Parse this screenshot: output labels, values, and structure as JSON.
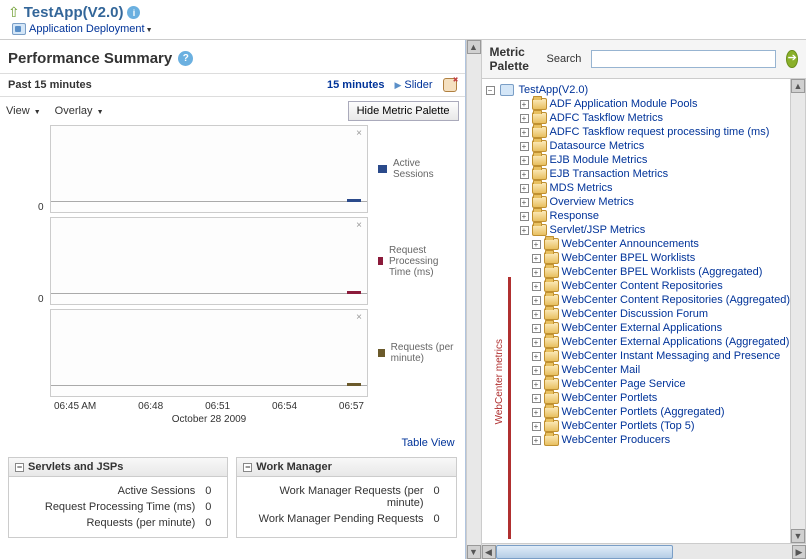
{
  "header": {
    "app_title": "TestApp(V2.0)",
    "deployment_menu": "Application Deployment"
  },
  "perf": {
    "title": "Performance Summary",
    "past_label": "Past 15 minutes",
    "minutes_link": "15 minutes",
    "slider": "Slider",
    "view_menu": "View",
    "overlay_menu": "Overlay",
    "hide_palette_btn": "Hide Metric Palette",
    "table_view": "Table View",
    "xaxis_date": "October 28 2009"
  },
  "chart_data": [
    {
      "type": "line",
      "legend": "Active Sessions",
      "color": "#2b4a8b",
      "x": [
        "06:45 AM",
        "06:48",
        "06:51",
        "06:54",
        "06:57"
      ],
      "values": [
        0,
        0,
        0,
        0,
        0
      ],
      "ylim": [
        0,
        null
      ],
      "y_tick": "0"
    },
    {
      "type": "line",
      "legend": "Request Processing Time (ms)",
      "color": "#8b1a3a",
      "x": [
        "06:45 AM",
        "06:48",
        "06:51",
        "06:54",
        "06:57"
      ],
      "values": [
        0,
        0,
        0,
        0,
        0
      ],
      "ylim": [
        0,
        null
      ],
      "y_tick": "0"
    },
    {
      "type": "line",
      "legend": "Requests (per minute)",
      "color": "#6b5a2b",
      "x": [
        "06:45 AM",
        "06:48",
        "06:51",
        "06:54",
        "06:57"
      ],
      "values": [
        0,
        0,
        0,
        0,
        0
      ],
      "ylim": [
        0,
        null
      ],
      "y_tick": ""
    }
  ],
  "xaxis_ticks": [
    "06:45 AM",
    "06:48",
    "06:51",
    "06:54",
    "06:57"
  ],
  "panels": {
    "servlets": {
      "title": "Servlets and JSPs",
      "rows": [
        {
          "k": "Active Sessions",
          "v": "0"
        },
        {
          "k": "Request Processing Time (ms)",
          "v": "0"
        },
        {
          "k": "Requests (per minute)",
          "v": "0"
        }
      ]
    },
    "workmgr": {
      "title": "Work Manager",
      "rows": [
        {
          "k": "Work Manager Requests (per minute)",
          "v": "0"
        },
        {
          "k": "Work Manager Pending Requests",
          "v": "0"
        }
      ]
    }
  },
  "palette": {
    "title": "Metric Palette",
    "search_label": "Search",
    "search_value": "",
    "root": "TestApp(V2.0)",
    "wc_label": "WebCenter metrics",
    "nodes": [
      {
        "label": "ADF Application Module Pools",
        "sub": false
      },
      {
        "label": "ADFC Taskflow Metrics",
        "sub": false
      },
      {
        "label": "ADFC Taskflow request processing time (ms)",
        "sub": false
      },
      {
        "label": "Datasource Metrics",
        "sub": false
      },
      {
        "label": "EJB Module Metrics",
        "sub": false
      },
      {
        "label": "EJB Transaction Metrics",
        "sub": false
      },
      {
        "label": "MDS Metrics",
        "sub": false
      },
      {
        "label": "Overview Metrics",
        "sub": false
      },
      {
        "label": "Response",
        "sub": false
      },
      {
        "label": "Servlet/JSP Metrics",
        "sub": false
      },
      {
        "label": "WebCenter Announcements",
        "sub": true
      },
      {
        "label": "WebCenter BPEL Worklists",
        "sub": true
      },
      {
        "label": "WebCenter BPEL Worklists (Aggregated)",
        "sub": true
      },
      {
        "label": "WebCenter Content Repositories",
        "sub": true
      },
      {
        "label": "WebCenter Content Repositories (Aggregated)",
        "sub": true
      },
      {
        "label": "WebCenter Discussion Forum",
        "sub": true
      },
      {
        "label": "WebCenter External Applications",
        "sub": true
      },
      {
        "label": "WebCenter External Applications (Aggregated)",
        "sub": true
      },
      {
        "label": "WebCenter Instant Messaging and Presence",
        "sub": true
      },
      {
        "label": "WebCenter Mail",
        "sub": true
      },
      {
        "label": "WebCenter Page Service",
        "sub": true
      },
      {
        "label": "WebCenter Portlets",
        "sub": true
      },
      {
        "label": "WebCenter Portlets (Aggregated)",
        "sub": true
      },
      {
        "label": "WebCenter Portlets (Top 5)",
        "sub": true
      },
      {
        "label": "WebCenter Producers",
        "sub": true
      }
    ]
  }
}
